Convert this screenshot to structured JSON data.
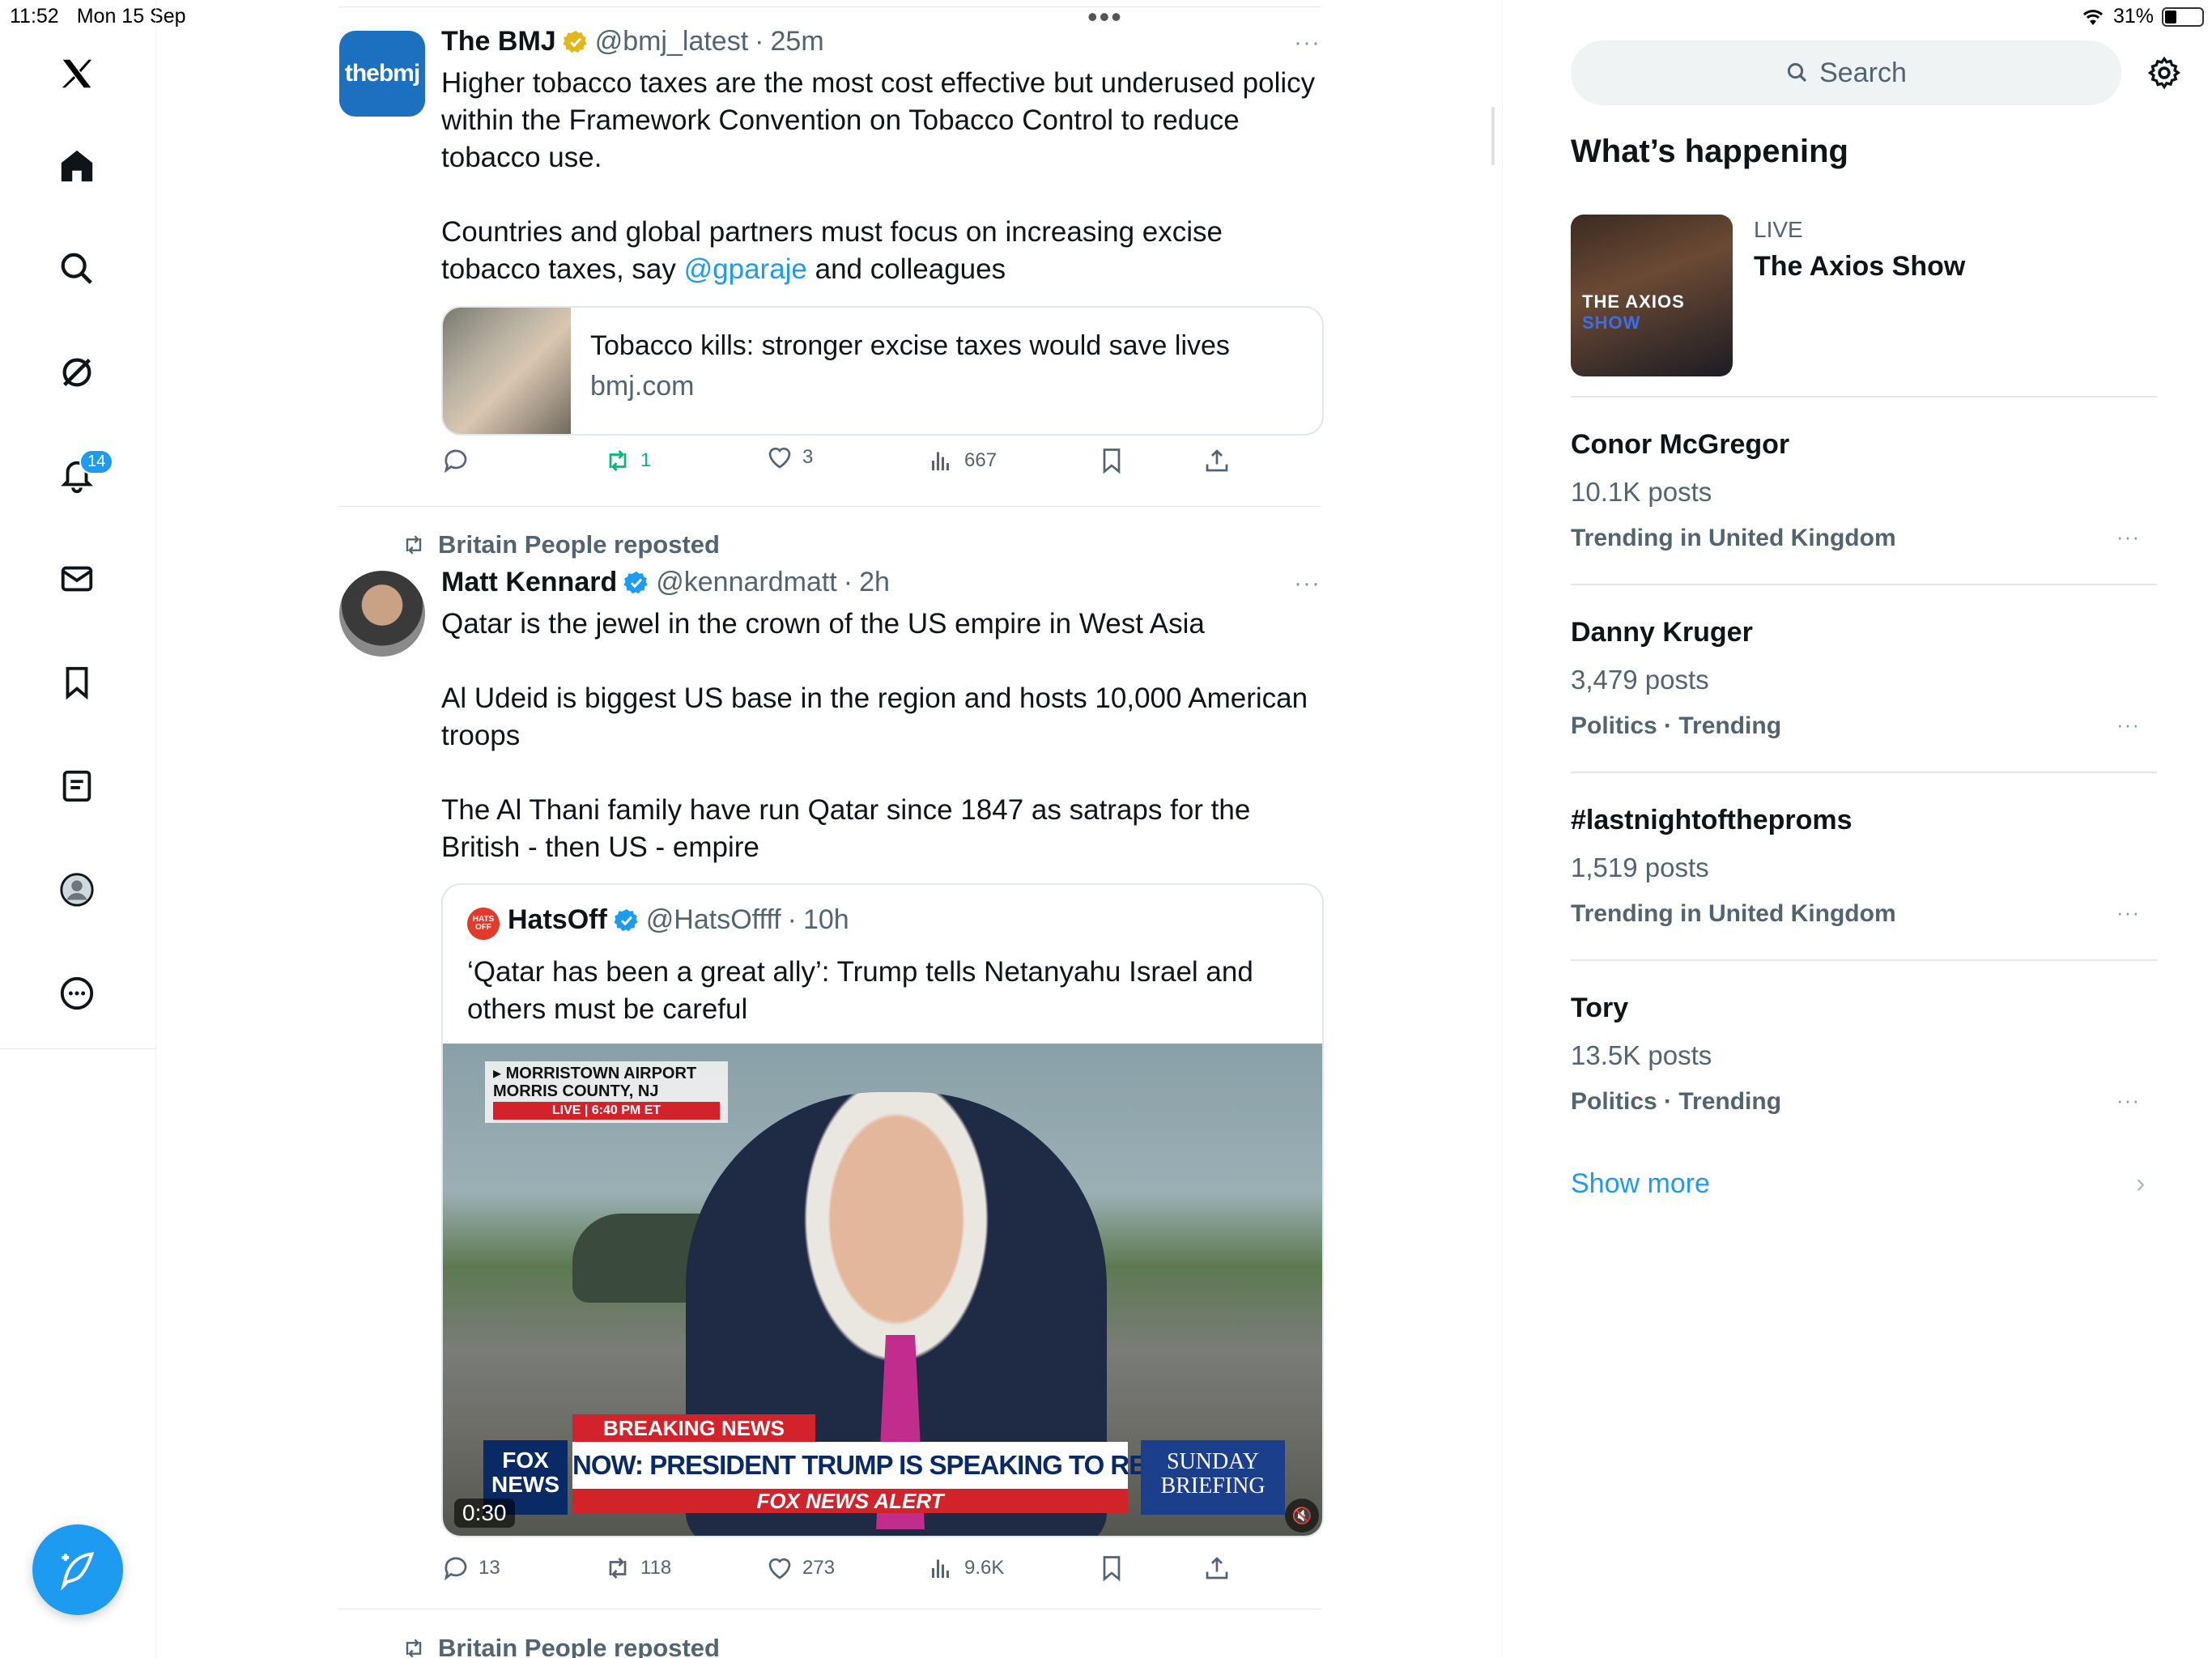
{
  "status_bar": {
    "time": "11:52",
    "date": "Mon 15 Sep",
    "battery": "31%"
  },
  "nav": {
    "items": [
      "home",
      "explore",
      "grok",
      "notifications",
      "messages",
      "bookmarks",
      "lists",
      "profile",
      "more"
    ],
    "notifications_badge": "14"
  },
  "feed": {
    "top_menu": "•••",
    "tweet1": {
      "name": "The BMJ",
      "avatar_text": "thebmj",
      "handle": "@bmj_latest",
      "time": "25m",
      "dot": "·",
      "text_p1": "Higher tobacco taxes are the most cost effective but underused policy within the Framework Convention on Tobacco Control to reduce tobacco use.",
      "text_p2_before": "Countries and global partners must focus on increasing excise tobacco taxes, say ",
      "mention": "@gparaje",
      "text_p2_after": " and colleagues",
      "card_title": "Tobacco kills: stronger excise taxes would save lives",
      "card_domain": "bmj.com",
      "replies": "",
      "reposts": "1",
      "likes": "3",
      "views": "667",
      "more": "···"
    },
    "tweet2": {
      "reposted_by": "Britain People reposted",
      "name": "Matt Kennard",
      "handle": "@kennardmatt",
      "time": "2h",
      "dot": "·",
      "text_p1": "Qatar is the jewel in the crown of the US empire in West Asia",
      "text_p2": "Al Udeid is biggest US base in the region and hosts 10,000 American troops",
      "text_p3": "The Al Thani family have run Qatar since 1847 as satraps for the British - then US - empire",
      "more": "···",
      "quote": {
        "avatar_text": "HATS OFF",
        "name": "HatsOff",
        "handle": "@HatsOffff",
        "time": "10h",
        "dot": "·",
        "text": "‘Qatar has been a great ally’: Trump tells Netanyahu Israel and others must be careful",
        "video": {
          "location_line1": "▸ MORRISTOWN AIRPORT",
          "location_line2": "MORRIS COUNTY, NJ",
          "live_line": "LIVE  |  6:40 PM ET",
          "breaking": "BREAKING NEWS",
          "headline": "NOW: PRESIDENT TRUMP IS SPEAKING TO REPORTERS",
          "alert": "FOX NEWS ALERT",
          "fox_line1": "FOX",
          "fox_line2": "NEWS",
          "sunday_line1": "SUNDAY",
          "sunday_line2": "BRIEFING",
          "timecode": "0:30",
          "mute_icon": "🔇"
        }
      },
      "replies": "13",
      "reposts": "118",
      "likes": "273",
      "views": "9.6K"
    },
    "tweet3_reposted_by": "Britain People reposted"
  },
  "sidebar": {
    "search_placeholder": "Search",
    "whats_happening": "What’s happening",
    "live": {
      "label": "LIVE",
      "title": "The Axios Show",
      "thumb_text_a": "THE AXIOS ",
      "thumb_text_b": "SHOW"
    },
    "trends": [
      {
        "name": "Conor McGregor",
        "count": "10.1K posts",
        "context": "Trending in United Kingdom"
      },
      {
        "name": "Danny Kruger",
        "count": "3,479 posts",
        "context": "Politics · Trending"
      },
      {
        "name": "#lastnightoftheproms",
        "count": "1,519 posts",
        "context": "Trending in United Kingdom"
      },
      {
        "name": "Tory",
        "count": "13.5K posts",
        "context": "Politics · Trending"
      }
    ],
    "trend_more": "···",
    "show_more": "Show more",
    "show_more_chevron": "›"
  },
  "colors": {
    "accent": "#1d9bf0",
    "repost_green": "#00ba7c",
    "muted": "#536471"
  }
}
